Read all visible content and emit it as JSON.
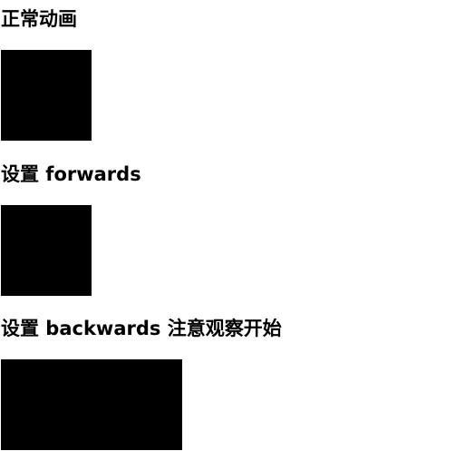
{
  "sections": [
    {
      "title": "正常动画",
      "box_color": "#000000"
    },
    {
      "title": "设置 forwards",
      "box_color": "#000000"
    },
    {
      "title": "设置 backwards 注意观察开始",
      "box_color": "#000000"
    }
  ]
}
